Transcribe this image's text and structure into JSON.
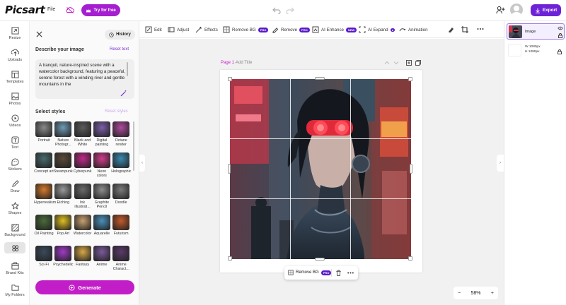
{
  "app": {
    "logo": "Picsart",
    "file_menu": "File",
    "try_button": "Try for free",
    "export_button": "Export"
  },
  "rail": [
    {
      "label": "Resize",
      "icon": "resize-icon"
    },
    {
      "label": "Uploads",
      "icon": "upload-icon"
    },
    {
      "label": "Templates",
      "icon": "templates-icon"
    },
    {
      "label": "Photos",
      "icon": "photos-icon"
    },
    {
      "label": "Videos",
      "icon": "videos-icon"
    },
    {
      "label": "Text",
      "icon": "text-icon"
    },
    {
      "label": "Stickers",
      "icon": "stickers-icon"
    },
    {
      "label": "Draw",
      "icon": "draw-icon"
    },
    {
      "label": "Shapes",
      "icon": "shapes-icon"
    },
    {
      "label": "Background",
      "icon": "background-icon"
    },
    {
      "label": "",
      "icon": "ai-tools-icon"
    },
    {
      "label": "Brand Kits",
      "icon": "brand-kits-icon"
    },
    {
      "label": "My Folders",
      "icon": "folders-icon"
    }
  ],
  "panel": {
    "history_button": "History",
    "describe_label": "Describe your image",
    "reset_text": "Reset text",
    "prompt": "A tranquil, nature-inspired scene with a watercolor background, featuring a peaceful, serene forest with a winding river and gentle mountains in the",
    "styles_label": "Select styles",
    "reset_styles": "Reset styles",
    "generate_button": "Generate",
    "styles": [
      {
        "name": "Portrait",
        "color": "#8a8a8a"
      },
      {
        "name": "Nature Photogr...",
        "color": "#6f9bb5"
      },
      {
        "name": "Black and White",
        "color": "#5c5c5c"
      },
      {
        "name": "Digital painting",
        "color": "#7c5fa8"
      },
      {
        "name": "Octane render",
        "color": "#b04a9e"
      },
      {
        "name": "Concept art",
        "color": "#4a6a6c"
      },
      {
        "name": "Steampunk",
        "color": "#5a4a3a"
      },
      {
        "name": "Cyberpunk",
        "color": "#c02a8a"
      },
      {
        "name": "Neon colors",
        "color": "#d23c8c"
      },
      {
        "name": "Holographic",
        "color": "#3a8ab0"
      },
      {
        "name": "Hyperrealism",
        "color": "#d47a2a"
      },
      {
        "name": "Etching",
        "color": "#9a9a9a"
      },
      {
        "name": "Ink illustrati...",
        "color": "#6a6a6a"
      },
      {
        "name": "Graphite Pencil",
        "color": "#8e8e8e"
      },
      {
        "name": "Doodle",
        "color": "#7a7a7a"
      },
      {
        "name": "Oil Painting",
        "color": "#4a6a3a"
      },
      {
        "name": "Pop Art",
        "color": "#e0c020"
      },
      {
        "name": "Watercolor",
        "color": "#c8a070"
      },
      {
        "name": "Aquarelle",
        "color": "#4a8fb8"
      },
      {
        "name": "Futurism",
        "color": "#c25a2a"
      },
      {
        "name": "Sci-Fi",
        "color": "#3a4a5a"
      },
      {
        "name": "Psychedelic",
        "color": "#a03ac8"
      },
      {
        "name": "Fantasy",
        "color": "#d8a848"
      },
      {
        "name": "Anime",
        "color": "#7a5a9a"
      },
      {
        "name": "Anime Charact...",
        "color": "#5a3a6a"
      }
    ]
  },
  "toolbar": {
    "tools": [
      {
        "label": "Edit",
        "icon": "edit-icon",
        "pro": ""
      },
      {
        "label": "Adjust",
        "icon": "adjust-icon",
        "pro": ""
      },
      {
        "label": "Effects",
        "icon": "effects-icon",
        "pro": ""
      },
      {
        "label": "Remove BG",
        "icon": "remove-bg-icon",
        "pro": "PRO"
      },
      {
        "label": "Remove",
        "icon": "remove-icon",
        "pro": "PRO"
      },
      {
        "label": "AI Enhance",
        "icon": "ai-enhance-icon",
        "pro": "NEW"
      },
      {
        "label": "AI Expand",
        "icon": "ai-expand-icon",
        "pro": "●"
      },
      {
        "label": "Animation",
        "icon": "animation-icon",
        "pro": ""
      }
    ]
  },
  "canvas": {
    "page_label": "Page 1 -",
    "page_title_placeholder": "Add Title",
    "floating_remove_bg": "Remove BG",
    "floating_pro": "PRO",
    "zoom": "58%"
  },
  "layers": {
    "items": [
      {
        "name": "Image"
      },
      {
        "name": ""
      }
    ],
    "width": "W 1080px",
    "height": "H 1080px"
  }
}
